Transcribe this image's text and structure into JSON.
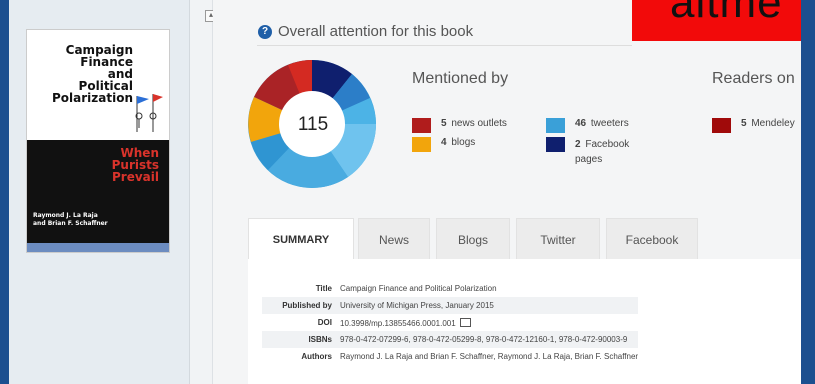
{
  "banner": {
    "text": "altme"
  },
  "book": {
    "cover_title_lines": [
      "Campaign",
      "Finance",
      "and",
      "Political",
      "Polarization"
    ],
    "cover_subtitle_lines": [
      "When",
      "Purists",
      "Prevail"
    ],
    "cover_author_lines": [
      "Raymond J. La Raja",
      "and Brian F. Schaffner"
    ]
  },
  "attention": {
    "title": "Overall attention for this book",
    "score": "115"
  },
  "mentioned_by": {
    "title": "Mentioned by",
    "items": [
      {
        "count": "5",
        "label": "news outlets",
        "color": "#b01c1c"
      },
      {
        "count": "4",
        "label": "blogs",
        "color": "#f2a50c"
      },
      {
        "count": "46",
        "label": "tweeters",
        "color": "#3aa0d8"
      },
      {
        "count": "2",
        "label": "Facebook pages",
        "color": "#0f1f6e"
      }
    ]
  },
  "readers": {
    "title": "Readers on",
    "items": [
      {
        "count": "5",
        "label": "Mendeley",
        "color": "#a00a0a"
      }
    ]
  },
  "tabs": [
    "SUMMARY",
    "News",
    "Blogs",
    "Twitter",
    "Facebook"
  ],
  "summary": {
    "rows": [
      {
        "key": "Title",
        "value": "Campaign Finance and Political Polarization"
      },
      {
        "key": "Published by",
        "value": "University of Michigan Press, January 2015"
      },
      {
        "key": "DOI",
        "value": "10.3998/mp.13855466.0001.001"
      },
      {
        "key": "ISBNs",
        "value": "978-0-472-07299-6, 978-0-472-05299-8, 978-0-472-12160-1, 978-0-472-90003-9"
      },
      {
        "key": "Authors",
        "value": "Raymond J. La Raja and Brian F. Schaffner, Raymond J. La Raja, Brian F. Schaffner"
      }
    ]
  },
  "icons": {
    "help": "question-circle-icon",
    "external": "external-link-icon",
    "collapse": "collapse-icon"
  }
}
